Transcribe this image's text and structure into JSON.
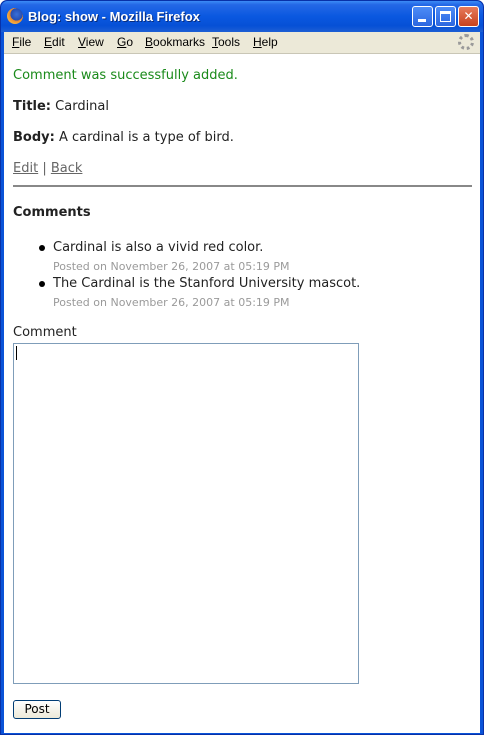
{
  "window": {
    "title": "Blog: show - Mozilla Firefox",
    "controls": {
      "minimize_icon": "minimize-icon",
      "maximize_icon": "maximize-icon",
      "close_icon": "close-icon"
    }
  },
  "menubar": {
    "items": [
      "File",
      "Edit",
      "View",
      "Go",
      "Bookmarks",
      "Tools",
      "Help"
    ],
    "throbber_icon": "throbber-icon"
  },
  "page": {
    "notice": "Comment was successfully added.",
    "title_label": "Title:",
    "title_value": "Cardinal",
    "body_label": "Body:",
    "body_value": "A cardinal is a type of bird.",
    "edit_link": "Edit",
    "separator": "|",
    "back_link": "Back",
    "comments_heading": "Comments",
    "comments": [
      {
        "text": "Cardinal is also a vivid red color.",
        "posted": "Posted on November 26, 2007 at 05:19 PM"
      },
      {
        "text": "The Cardinal is the Stanford University mascot.",
        "posted": "Posted on November 26, 2007 at 05:19 PM"
      }
    ],
    "comment_label": "Comment",
    "comment_value": "",
    "post_button": "Post"
  },
  "colors": {
    "notice": "#1a8a1a",
    "titlebar": "#0a58e0",
    "link": "#666666"
  }
}
